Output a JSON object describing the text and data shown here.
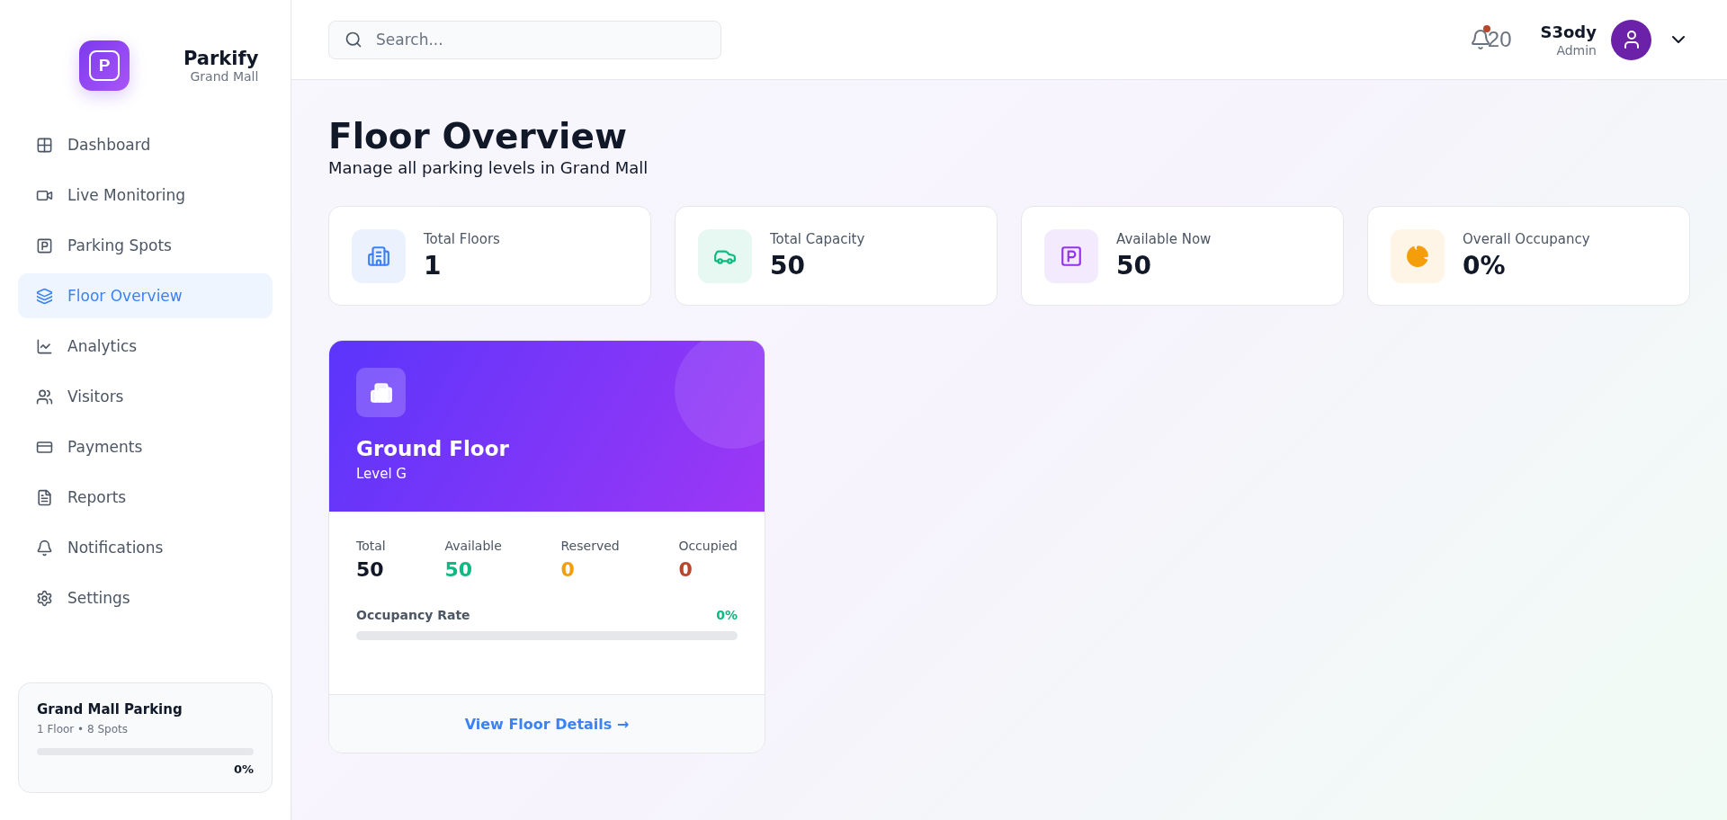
{
  "brand": {
    "logo_letter": "P",
    "name": "Parkify",
    "subtitle": "Grand Mall"
  },
  "nav": [
    {
      "label": "Dashboard",
      "selected": false
    },
    {
      "label": "Live Monitoring",
      "selected": false
    },
    {
      "label": "Parking Spots",
      "selected": false
    },
    {
      "label": "Floor Overview",
      "selected": true
    },
    {
      "label": "Analytics",
      "selected": false
    },
    {
      "label": "Visitors",
      "selected": false
    },
    {
      "label": "Payments",
      "selected": false
    },
    {
      "label": "Reports",
      "selected": false
    },
    {
      "label": "Notifications",
      "selected": false
    },
    {
      "label": "Settings",
      "selected": false
    }
  ],
  "site_card": {
    "title": "Grand Mall Parking",
    "subtitle": "1 Floor • 8 Spots",
    "level": 0,
    "reading": "0%"
  },
  "search": {
    "placeholder": "Search..."
  },
  "notifications": {
    "count": "20",
    "unread": true
  },
  "user": {
    "name": "S3ody",
    "role": "Admin"
  },
  "page": {
    "title": "Floor Overview",
    "subtitle": "Manage all parking levels in Grand Mall"
  },
  "stats": [
    {
      "label": "Total Floors",
      "value": "1",
      "color": "#3b82f6"
    },
    {
      "label": "Total Capacity",
      "value": "50",
      "color": "#10b981"
    },
    {
      "label": "Available Now",
      "value": "50",
      "color": "#9333ea"
    },
    {
      "label": "Overall Occupancy",
      "value": "0%",
      "color": "#f59e0b"
    }
  ],
  "floors": [
    {
      "name": "Ground Floor",
      "level_label": "Level G",
      "stats": [
        {
          "label": "Total",
          "value": "50",
          "color": "#111827"
        },
        {
          "label": "Available",
          "value": "50",
          "color": "#10b981"
        },
        {
          "label": "Reserved",
          "value": "0",
          "color": "#f59e0b"
        },
        {
          "label": "Occupied",
          "value": "0",
          "color": "#b9472a"
        }
      ],
      "rate_label": "Occupancy Rate",
      "rate_value": "0%",
      "level": 0,
      "link": "View Floor Details →"
    }
  ]
}
